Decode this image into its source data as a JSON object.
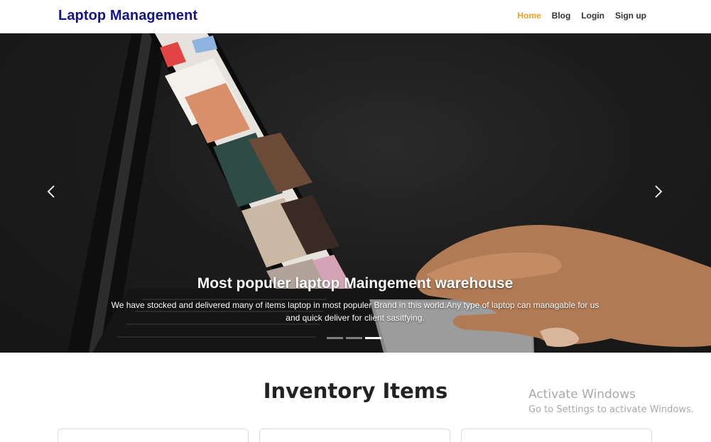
{
  "navbar": {
    "brand": "Laptop Management",
    "links": [
      {
        "label": "Home",
        "active": true
      },
      {
        "label": "Blog",
        "active": false
      },
      {
        "label": "Login",
        "active": false
      },
      {
        "label": "Sign up",
        "active": false
      }
    ]
  },
  "carousel": {
    "caption_title": "Most populer laptop Maingement warehouse",
    "caption_text": "We have stocked and delivered many of items laptop in most populer Brand in this world.Any type of laptop can managable for us and quick deliver for client sasitfying.",
    "prev_icon": "chevron-left-icon",
    "next_icon": "chevron-right-icon",
    "slide_count": 3,
    "active_slide": 3
  },
  "inventory": {
    "title": "Inventory Items"
  },
  "watermark": {
    "title": "Activate Windows",
    "subtitle": "Go to Settings to activate Windows."
  },
  "colors": {
    "brand": "#14148a",
    "nav_active": "#e8a319",
    "hero_bg": "#1c1c1c"
  }
}
